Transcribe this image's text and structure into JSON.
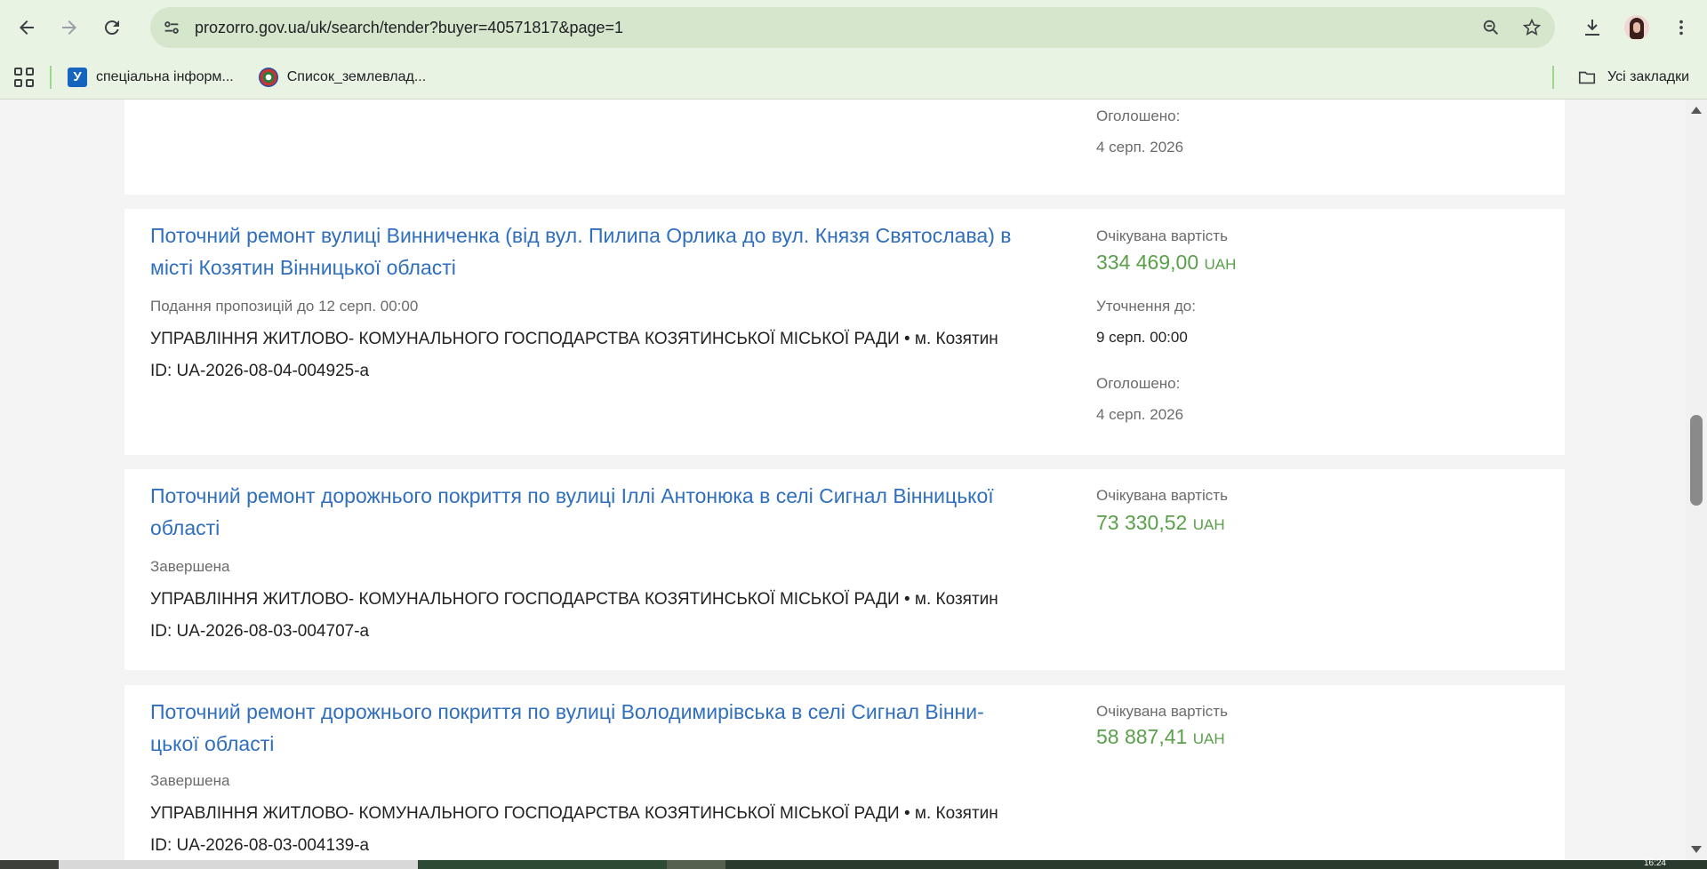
{
  "browser": {
    "url_host": "prozorro.gov.ua",
    "url_path": "/uk/search/tender?buyer=40571817&page=1",
    "bookmarks": [
      {
        "label": "спеціальна інформ...",
        "icon": "u-favicon"
      },
      {
        "label": "Список_землевлад...",
        "icon": "wiki-favicon"
      }
    ],
    "all_bookmarks_label": "Усі закладки"
  },
  "cards": [
    {
      "announced_label": "Оголошено:",
      "announced_date": "4 серп. 2026"
    },
    {
      "title_line1": "Поточний ремонт вулиці Винниченка (від вул. Пилипа Орлика до вул. Князя Святослава) в",
      "title_line2": "місті Козятин Вінницької області",
      "status": "Подання пропозицій до 12 серп. 00:00",
      "buyer": "УПРАВЛІННЯ ЖИТЛОВО- КОМУНАЛЬНОГО ГОСПОДАРСТВА КОЗЯТИНСЬКОЇ МІСЬКОЇ РАДИ • м. Козятин",
      "id": "ID: UA-2026-08-04-004925-a",
      "expected_label": "Очікувана вартість",
      "price": "334 469,00",
      "currency": "UAH",
      "clarify_label": "Уточнення до:",
      "clarify_date": "9 серп. 00:00",
      "announced_label": "Оголошено:",
      "announced_date": "4 серп. 2026"
    },
    {
      "title_line1": "Поточний ремонт дорожнього покриття по вулиці Іллі Антонюка в селі Сигнал Вінницької",
      "title_line2": "області",
      "status": "Завершена",
      "buyer": "УПРАВЛІННЯ ЖИТЛОВО- КОМУНАЛЬНОГО ГОСПОДАРСТВА КОЗЯТИНСЬКОЇ МІСЬКОЇ РАДИ • м. Козятин",
      "id": "ID: UA-2026-08-03-004707-a",
      "expected_label": "Очікувана вартість",
      "price": "73 330,52",
      "currency": "UAH"
    },
    {
      "title_line1": "Поточний ремонт дорожнього покриття по вулиці Володимирівська в селі Сигнал Вінни-",
      "title_line2": "цької області",
      "status": "Завершена",
      "buyer": "УПРАВЛІННЯ ЖИТЛОВО- КОМУНАЛЬНОГО ГОСПОДАРСТВА КОЗЯТИНСЬКОЇ МІСЬКОЇ РАДИ • м. Козятин",
      "id": "ID: UA-2026-08-03-004139-a",
      "expected_label": "Очікувана вартість",
      "price": "58 887,41",
      "currency": "UAH"
    }
  ],
  "taskbar": {
    "time": "16:24"
  }
}
